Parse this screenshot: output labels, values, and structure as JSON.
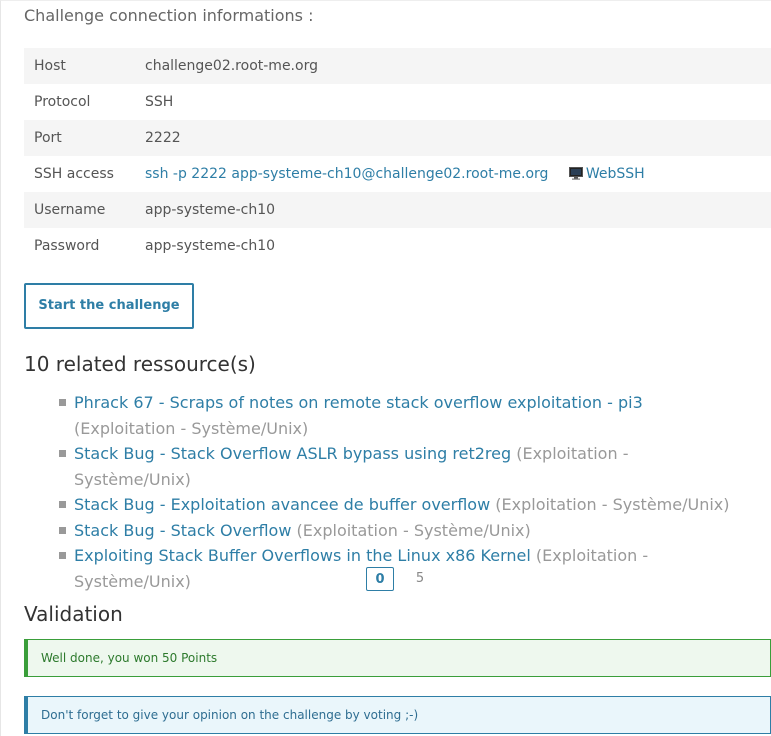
{
  "connection": {
    "title": "Challenge connection informations :",
    "rows": [
      {
        "key": "Host",
        "value": "challenge02.root-me.org"
      },
      {
        "key": "Protocol",
        "value": "SSH"
      },
      {
        "key": "Port",
        "value": "2222"
      },
      {
        "key": "SSH access",
        "value": "ssh -p 2222 app-systeme-ch10@challenge02.root-me.org",
        "extra": "WebSSH"
      },
      {
        "key": "Username",
        "value": "app-systeme-ch10"
      },
      {
        "key": "Password",
        "value": "app-systeme-ch10"
      }
    ],
    "start_button": "Start the challenge"
  },
  "resources": {
    "title": "10 related ressource(s)",
    "items": [
      {
        "title": "Phrack 67 - Scraps of notes on remote stack overflow exploitation - pi3",
        "category": "(Exploitation - Système/Unix)"
      },
      {
        "title": "Stack Bug - Stack Overflow ASLR bypass using ret2reg",
        "category": "(Exploitation - Système/Unix)"
      },
      {
        "title": "Stack Bug - Exploitation avancee de buffer overflow",
        "category": "(Exploitation - Système/Unix)"
      },
      {
        "title": "Stack Bug - Stack Overflow",
        "category": "(Exploitation - Système/Unix)"
      },
      {
        "title": "Exploiting Stack Buffer Overflows in the Linux x86 Kernel",
        "category": "(Exploitation - Système/Unix)"
      }
    ],
    "pagination": {
      "current": "0",
      "next": "5"
    }
  },
  "validation": {
    "title": "Validation",
    "success_message": "Well done, you won 50 Points",
    "info_message": "Don't forget to give your opinion on the challenge by voting ;-)"
  },
  "colors": {
    "link": "#2e7ea6",
    "success": "#3a9e3a",
    "info": "#2e7ea6"
  }
}
